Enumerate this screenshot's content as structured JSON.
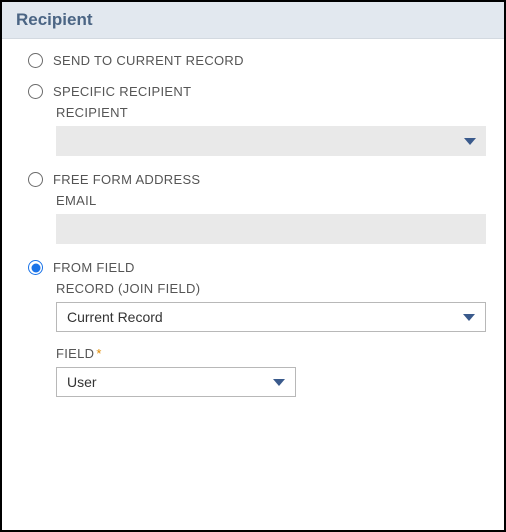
{
  "panel": {
    "title": "Recipient"
  },
  "options": {
    "sendToCurrent": {
      "label": "SEND TO CURRENT RECORD",
      "selected": false
    },
    "specificRecipient": {
      "label": "SPECIFIC RECIPIENT",
      "selected": false,
      "recipientLabel": "RECIPIENT",
      "recipientValue": ""
    },
    "freeForm": {
      "label": "FREE FORM ADDRESS",
      "selected": false,
      "emailLabel": "EMAIL",
      "emailValue": ""
    },
    "fromField": {
      "label": "FROM FIELD",
      "selected": true,
      "recordLabel": "RECORD (JOIN FIELD)",
      "recordValue": "Current Record",
      "fieldLabel": "FIELD",
      "fieldValue": "User"
    }
  },
  "requiredMark": "*"
}
